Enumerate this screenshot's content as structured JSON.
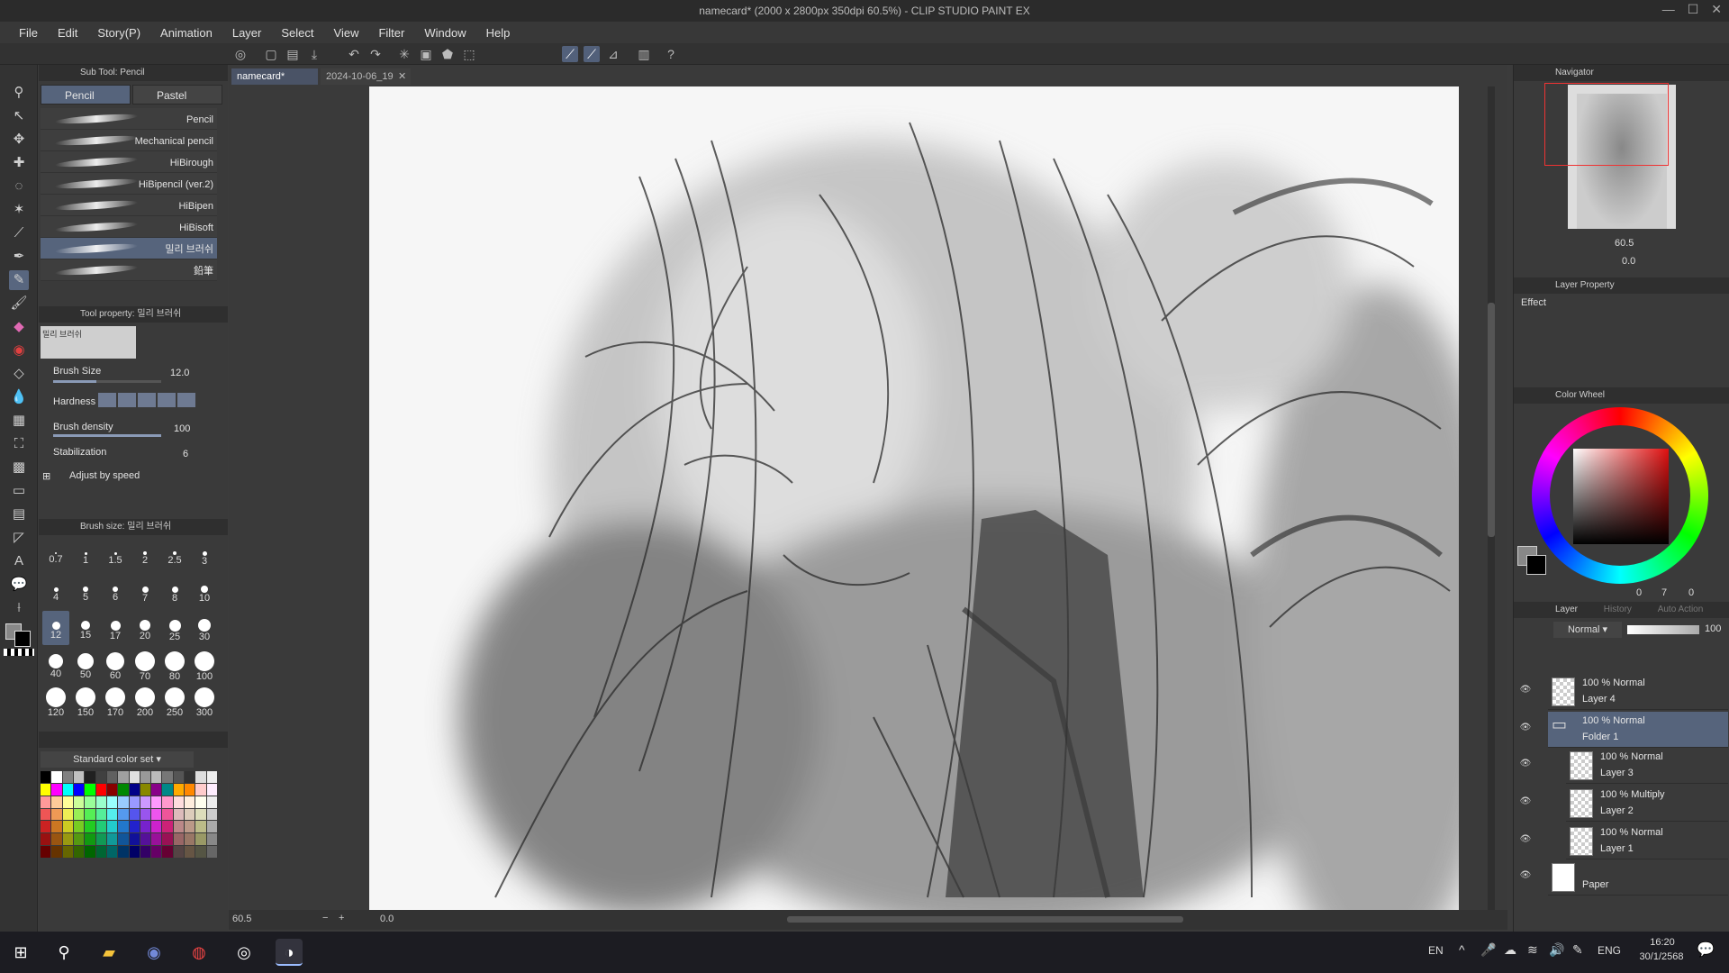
{
  "window": {
    "title": "namecard* (2000 x 2800px 350dpi 60.5%)  - CLIP STUDIO PAINT EX"
  },
  "menu": [
    "File",
    "Edit",
    "Story(P)",
    "Animation",
    "Layer",
    "Select",
    "View",
    "Filter",
    "Window",
    "Help"
  ],
  "subtool": {
    "header": "Sub Tool: Pencil",
    "tabs": [
      "Pencil",
      "Pastel"
    ],
    "brushes": [
      "Pencil",
      "Mechanical pencil",
      "HiBirough",
      "HiBipencil (ver.2)",
      "HiBipen",
      "HiBisoft",
      "밀리 브러쉬",
      "鉛筆"
    ]
  },
  "toolprop": {
    "header": "Tool property: 밀리 브러쉬",
    "preview_label": "밀리 브러쉬",
    "brush_size_label": "Brush Size",
    "brush_size_value": "12.0",
    "hardness_label": "Hardness",
    "density_label": "Brush density",
    "density_value": "100",
    "stabilization_label": "Stabilization",
    "stabilization_value": "6",
    "adjust_label": "Adjust by speed"
  },
  "brushsize": {
    "header": "Brush size: 밀리 브러쉬",
    "sizes": [
      "0.7",
      "1",
      "1.5",
      "2",
      "2.5",
      "3",
      "4",
      "5",
      "6",
      "7",
      "8",
      "10",
      "12",
      "15",
      "17",
      "20",
      "25",
      "30",
      "40",
      "50",
      "60",
      "70",
      "80",
      "100",
      "120",
      "150",
      "170",
      "200",
      "250",
      "300"
    ]
  },
  "colorset": {
    "name": "Standard color set"
  },
  "doc": {
    "tab1": "namecard*",
    "tab2": "2024-10-06_19"
  },
  "status": {
    "zoom": "60.5",
    "angle": "0.0"
  },
  "navigator": {
    "header": "Navigator",
    "zoom": "60.5",
    "angle": "0.0"
  },
  "layerprop": {
    "header": "Layer Property",
    "effect": "Effect"
  },
  "colorwheel": {
    "header": "Color Wheel",
    "values": "0",
    "v2": "7",
    "v3": "0"
  },
  "layers": {
    "tabs": [
      "Layer",
      "History",
      "Auto Action"
    ],
    "blend": "Normal",
    "opacity": "100",
    "items": [
      {
        "mode": "100 % Normal",
        "name": "Layer 4"
      },
      {
        "mode": "100 % Normal",
        "name": "Folder 1"
      },
      {
        "mode": "100 % Normal",
        "name": "Layer 3"
      },
      {
        "mode": "100 % Multiply",
        "name": "Layer 2"
      },
      {
        "mode": "100 % Normal",
        "name": "Layer 1"
      },
      {
        "mode": "",
        "name": "Paper"
      }
    ]
  },
  "taskbar": {
    "lang1": "EN",
    "lang2": "ENG",
    "time": "16:20",
    "date": "30/1/2568"
  },
  "colors": {
    "accent": "#56647c",
    "panel": "#3a3a3a"
  }
}
